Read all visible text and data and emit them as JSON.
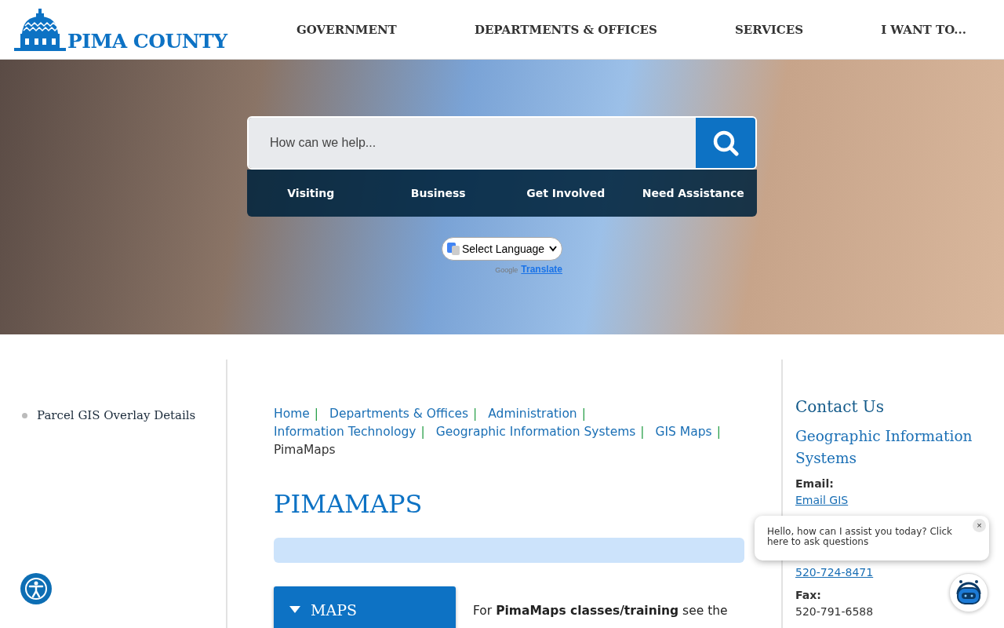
{
  "header": {
    "logo": "PIMA COUNTY",
    "nav": [
      "GOVERNMENT",
      "DEPARTMENTS & OFFICES",
      "SERVICES",
      "I WANT TO..."
    ]
  },
  "hero": {
    "search": {
      "placeholder": "How can we help..."
    },
    "quick_links": [
      "Visiting",
      "Business",
      "Get Involved",
      "Need Assistance"
    ],
    "language": {
      "value": "Select Language",
      "powered_by": "Google",
      "link": "Translate"
    }
  },
  "sidebar": {
    "items": [
      "Parcel GIS Overlay Details"
    ]
  },
  "breadcrumb": {
    "separator": "|",
    "items": [
      {
        "label": "Home",
        "current": false
      },
      {
        "label": "Departments & Offices",
        "current": false
      },
      {
        "label": "Administration",
        "current": false
      },
      {
        "label": "Information Technology",
        "current": false
      },
      {
        "label": "Geographic Information Systems",
        "current": false
      },
      {
        "label": "GIS Maps",
        "current": false
      },
      {
        "label": "PimaMaps",
        "current": true
      }
    ]
  },
  "title": "PIMAMAPS",
  "accordion": {
    "label": "MAPS",
    "expanded": true
  },
  "intro": "For **PimaMaps classes/training** see the",
  "contact": {
    "heading": "Contact Us",
    "department": "Geographic Information Systems",
    "email_label": "Email:",
    "emails": [
      "Email GIS"
    ],
    "phone": "520-724-8471",
    "fax_label": "Fax:",
    "fax": "520-791-6588"
  },
  "chat": {
    "message": "Hello, how can I assist you today? Click here to ask questions",
    "close": "×"
  }
}
